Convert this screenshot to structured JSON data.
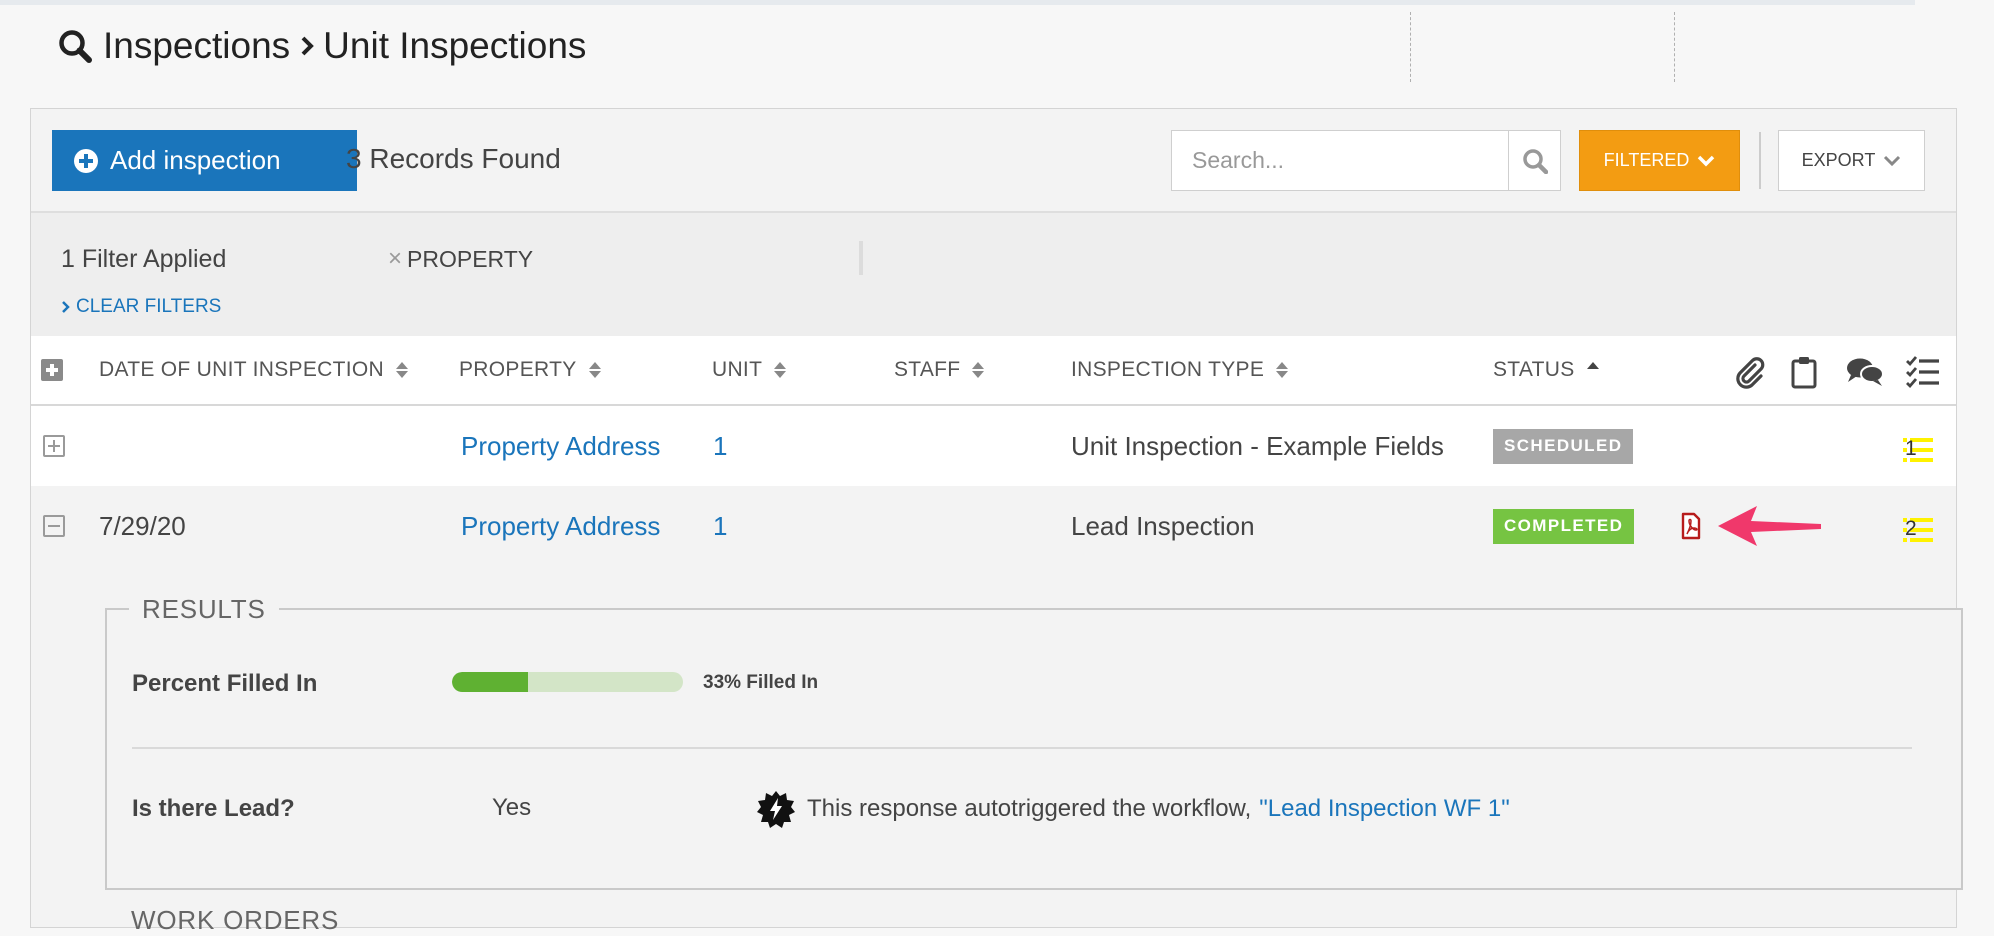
{
  "breadcrumb": {
    "root": "Inspections",
    "current": "Unit Inspections"
  },
  "toolbar": {
    "add_label": "Add inspection",
    "records_found": "3 Records Found",
    "search_placeholder": "Search...",
    "filtered_label": "FILTERED",
    "export_label": "EXPORT",
    "filtered_color": "#f39c12",
    "primary_color": "#1a75bb"
  },
  "filters": {
    "applied_text": "1 Filter Applied",
    "chips": [
      "PROPERTY"
    ],
    "clear_label": "CLEAR FILTERS"
  },
  "table": {
    "columns": [
      "DATE OF UNIT INSPECTION",
      "PROPERTY",
      "UNIT",
      "STAFF",
      "INSPECTION TYPE",
      "STATUS"
    ],
    "sorted_column": "STATUS",
    "action_icons": [
      "paperclip-icon",
      "clipboard-icon",
      "comments-icon",
      "checklist-icon"
    ],
    "rows": [
      {
        "date": "",
        "property": "Property Address",
        "unit": "1",
        "staff": "",
        "inspection_type": "Unit Inspection - Example Fields",
        "status": "SCHEDULED",
        "checklist_count": "1",
        "expanded": false
      },
      {
        "date": "7/29/20",
        "property": "Property Address",
        "unit": "1",
        "staff": "",
        "inspection_type": "Lead Inspection",
        "status": "COMPLETED",
        "checklist_count": "2",
        "has_pdf": true,
        "expanded": true
      }
    ]
  },
  "results": {
    "legend": "RESULTS",
    "percent_label": "Percent Filled In",
    "percent_value": 0.33,
    "percent_text": "33% Filled In",
    "question": "Is there Lead?",
    "answer": "Yes",
    "autotrigger_text": "This response autotriggered the workflow,",
    "workflow_link": "\"Lead Inspection WF 1\""
  },
  "work_orders_legend": "WORK ORDERS",
  "colors": {
    "scheduled": "#a7a7a7",
    "completed": "#76c442",
    "pdf": "#b71c1c",
    "arrow": "#f0386b",
    "highlight": "#fff200"
  }
}
